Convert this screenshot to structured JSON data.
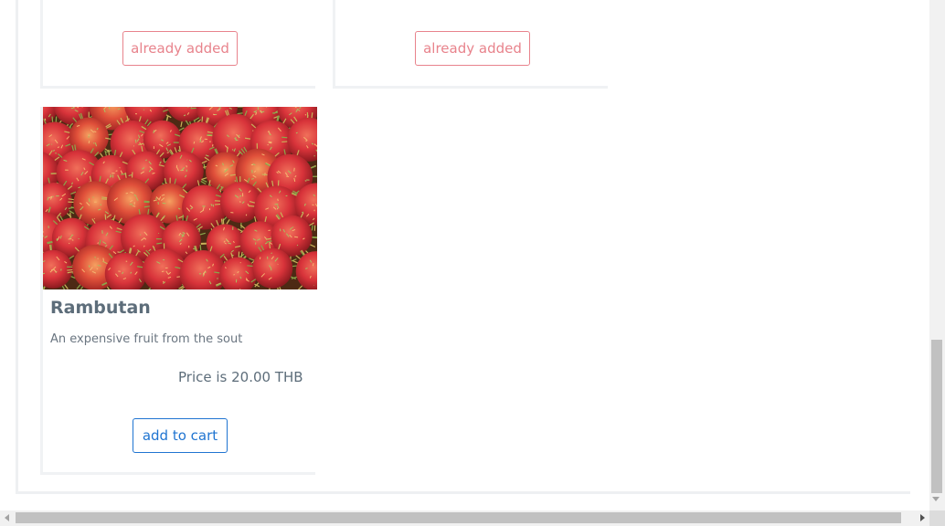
{
  "products": [
    {
      "button_label": "already added",
      "button_state": "added"
    },
    {
      "button_label": "already added",
      "button_state": "added"
    },
    {
      "title": "Rambutan",
      "description": "An expensive fruit from the sout",
      "price_text": "Price is 20.00 THB",
      "button_label": "add to cart",
      "button_state": "available",
      "image_alt": "rambutan-photo"
    }
  ],
  "colors": {
    "added_button": "#e8838c",
    "cart_button": "#1f74d1",
    "title_text": "#5d6d7a",
    "card_border": "#f0f2f4"
  },
  "icons": {
    "scroll_up": "triangle-up-icon",
    "scroll_down": "triangle-down-icon",
    "scroll_left": "triangle-left-icon",
    "scroll_right": "triangle-right-icon"
  }
}
